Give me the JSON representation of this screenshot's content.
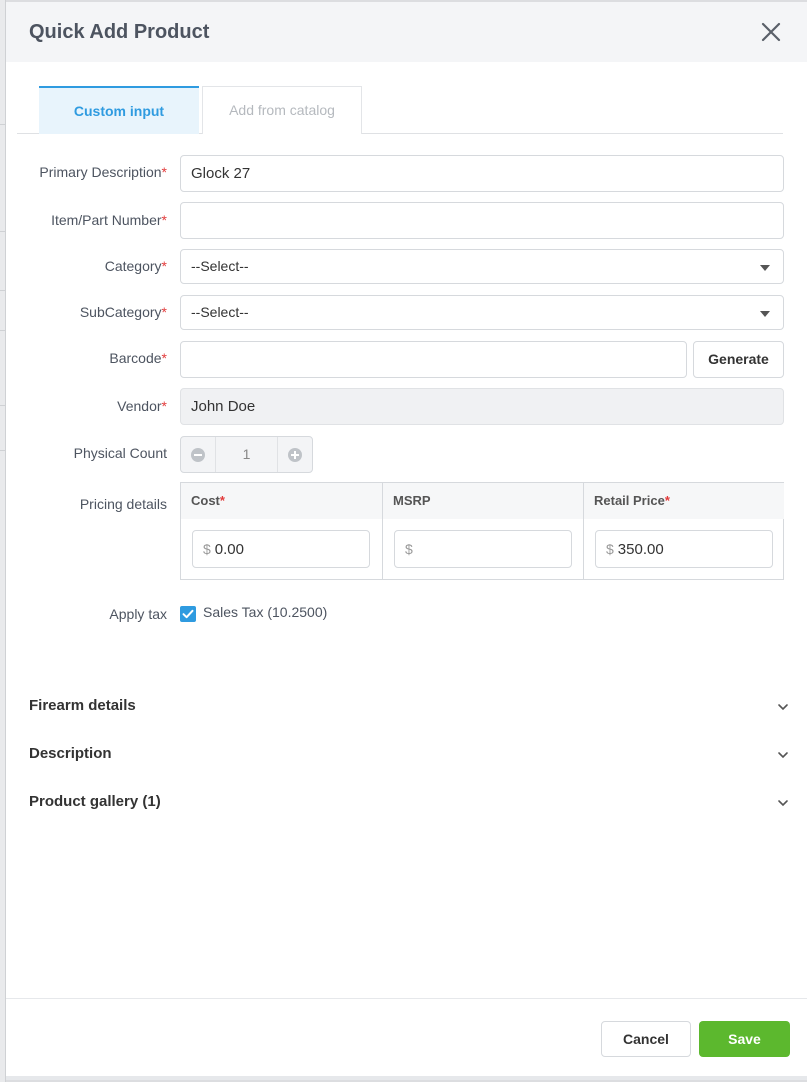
{
  "modal": {
    "title": "Quick Add Product"
  },
  "tabs": [
    {
      "label": "Custom input",
      "active": true
    },
    {
      "label": "Add from catalog",
      "active": false
    }
  ],
  "required_mark": "*",
  "form": {
    "primary_description": {
      "label": "Primary Description",
      "value": "Glock 27"
    },
    "item_part_number": {
      "label": "Item/Part Number",
      "value": ""
    },
    "category": {
      "label": "Category",
      "value": "--Select--"
    },
    "subcategory": {
      "label": "SubCategory",
      "value": "--Select--"
    },
    "barcode": {
      "label": "Barcode",
      "value": "",
      "generate_label": "Generate"
    },
    "vendor": {
      "label": "Vendor",
      "value": "John Doe"
    },
    "physical_count": {
      "label": "Physical Count",
      "value": "1"
    },
    "pricing": {
      "label": "Pricing details",
      "currency": "$",
      "cost": {
        "header": "Cost",
        "value": "0.00"
      },
      "msrp": {
        "header": "MSRP",
        "value": ""
      },
      "retail_price": {
        "header": "Retail Price",
        "value": "350.00"
      }
    },
    "apply_tax": {
      "label": "Apply tax",
      "option": "Sales Tax (10.2500)",
      "checked": true
    }
  },
  "sections": [
    {
      "title": "Firearm details"
    },
    {
      "title": "Description"
    },
    {
      "title": "Product gallery (1)"
    }
  ],
  "footer": {
    "cancel_label": "Cancel",
    "save_label": "Save"
  },
  "colors": {
    "accent": "#2f9be0",
    "save": "#5cb82e",
    "required": "#e23b3b"
  }
}
